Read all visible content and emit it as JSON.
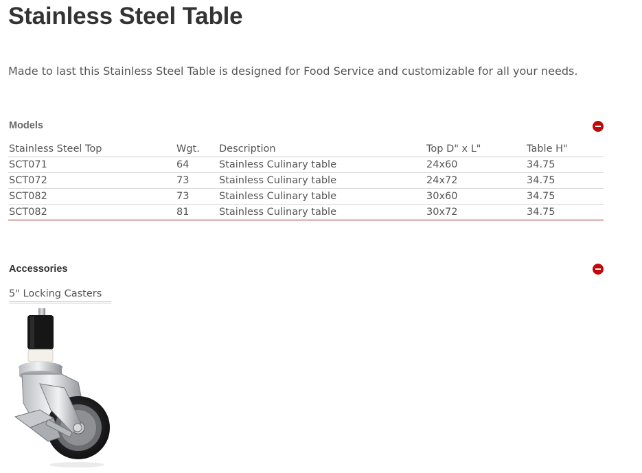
{
  "page": {
    "title": "Stainless Steel Table",
    "intro": "Made to last this Stainless Steel Table is designed for Food Service and customizable for all your needs."
  },
  "models": {
    "heading": "Models",
    "collapse_icon": "minus-circle-icon",
    "columns": [
      "Stainless Steel Top",
      "Wgt.",
      "Description",
      "Top D\" x L\"",
      "Table H\""
    ],
    "rows": [
      [
        "SCT071",
        "64",
        "Stainless Culinary table",
        "24x60",
        "34.75"
      ],
      [
        "SCT072",
        "73",
        "Stainless Culinary table",
        "24x72",
        "34.75"
      ],
      [
        "SCT082",
        "73",
        "Stainless Culinary table",
        "30x60",
        "34.75"
      ],
      [
        "SCT082",
        "81",
        "Stainless Culinary table",
        "30x72",
        "34.75"
      ]
    ]
  },
  "accessories": {
    "heading": "Accessories",
    "collapse_icon": "minus-circle-icon",
    "items": [
      {
        "label": "5\" Locking Casters",
        "image_icon": "locking-caster-image"
      }
    ]
  },
  "colors": {
    "accent": "#c00a0a",
    "table_bottom_rule": "#9b1b1b"
  }
}
